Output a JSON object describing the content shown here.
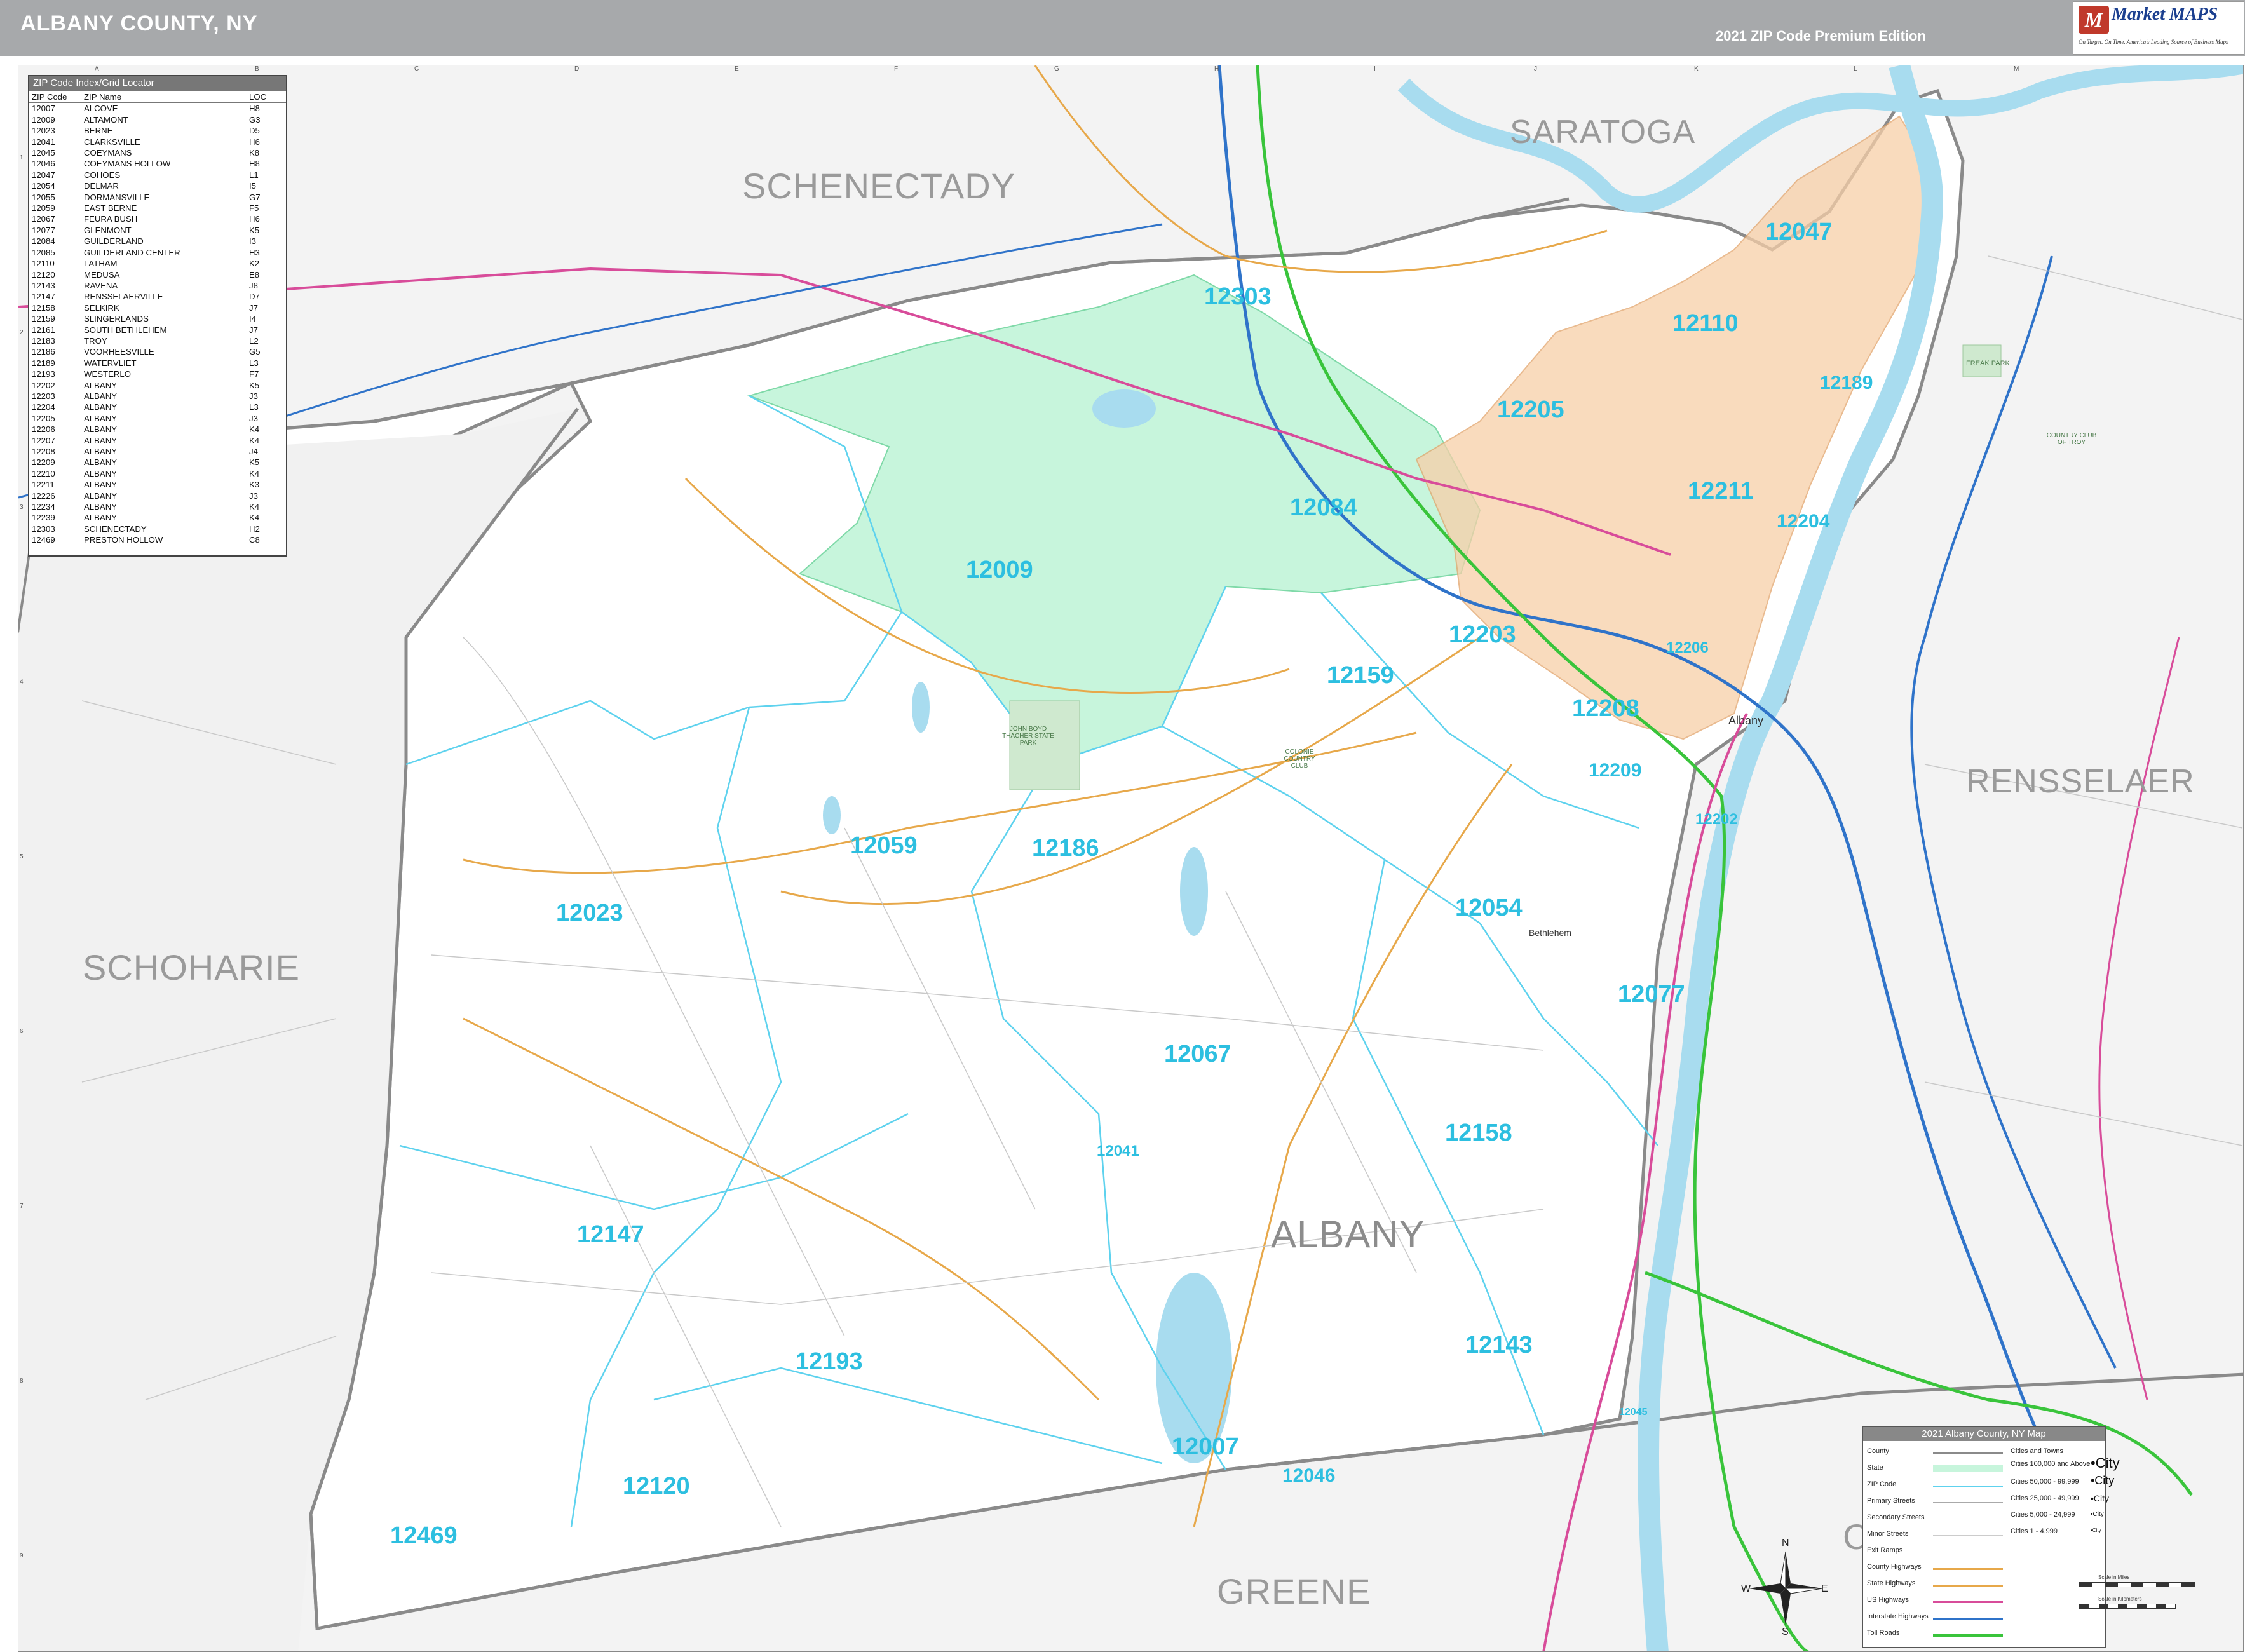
{
  "header": {
    "title": "ALBANY COUNTY, NY",
    "edition": "2021 ZIP Code Premium Edition",
    "logo": {
      "brand": "Market MAPS",
      "mark": "M",
      "tagline": "On Target.  On Time.  America's Leading Source of Business Maps"
    }
  },
  "grid": {
    "columns": [
      "A",
      "B",
      "C",
      "D",
      "E",
      "F",
      "G",
      "H",
      "I",
      "J",
      "K",
      "L",
      "M"
    ],
    "rows": [
      "1",
      "2",
      "3",
      "4",
      "5",
      "6",
      "7",
      "8",
      "9"
    ]
  },
  "index": {
    "title": "ZIP Code Index/Grid Locator",
    "headers": [
      "ZIP Code",
      "ZIP Name",
      "LOC"
    ],
    "rows": [
      [
        "12007",
        "ALCOVE",
        "H8"
      ],
      [
        "12009",
        "ALTAMONT",
        "G3"
      ],
      [
        "12023",
        "BERNE",
        "D5"
      ],
      [
        "12041",
        "CLARKSVILLE",
        "H6"
      ],
      [
        "12045",
        "COEYMANS",
        "K8"
      ],
      [
        "12046",
        "COEYMANS HOLLOW",
        "H8"
      ],
      [
        "12047",
        "COHOES",
        "L1"
      ],
      [
        "12054",
        "DELMAR",
        "I5"
      ],
      [
        "12055",
        "DORMANSVILLE",
        "G7"
      ],
      [
        "12059",
        "EAST BERNE",
        "F5"
      ],
      [
        "12067",
        "FEURA BUSH",
        "H6"
      ],
      [
        "12077",
        "GLENMONT",
        "K5"
      ],
      [
        "12084",
        "GUILDERLAND",
        "I3"
      ],
      [
        "12085",
        "GUILDERLAND CENTER",
        "H3"
      ],
      [
        "12110",
        "LATHAM",
        "K2"
      ],
      [
        "12120",
        "MEDUSA",
        "E8"
      ],
      [
        "12143",
        "RAVENA",
        "J8"
      ],
      [
        "12147",
        "RENSSELAERVILLE",
        "D7"
      ],
      [
        "12158",
        "SELKIRK",
        "J7"
      ],
      [
        "12159",
        "SLINGERLANDS",
        "I4"
      ],
      [
        "12161",
        "SOUTH BETHLEHEM",
        "J7"
      ],
      [
        "12183",
        "TROY",
        "L2"
      ],
      [
        "12186",
        "VOORHEESVILLE",
        "G5"
      ],
      [
        "12189",
        "WATERVLIET",
        "L3"
      ],
      [
        "12193",
        "WESTERLO",
        "F7"
      ],
      [
        "12202",
        "ALBANY",
        "K5"
      ],
      [
        "12203",
        "ALBANY",
        "J3"
      ],
      [
        "12204",
        "ALBANY",
        "L3"
      ],
      [
        "12205",
        "ALBANY",
        "J3"
      ],
      [
        "12206",
        "ALBANY",
        "K4"
      ],
      [
        "12207",
        "ALBANY",
        "K4"
      ],
      [
        "12208",
        "ALBANY",
        "J4"
      ],
      [
        "12209",
        "ALBANY",
        "K5"
      ],
      [
        "12210",
        "ALBANY",
        "K4"
      ],
      [
        "12211",
        "ALBANY",
        "K3"
      ],
      [
        "12226",
        "ALBANY",
        "J3"
      ],
      [
        "12234",
        "ALBANY",
        "K4"
      ],
      [
        "12239",
        "ALBANY",
        "K4"
      ],
      [
        "12303",
        "SCHENECTADY",
        "H2"
      ],
      [
        "12469",
        "PRESTON HOLLOW",
        "C8"
      ]
    ]
  },
  "counties": {
    "schenectady": "SCHENECTADY",
    "saratoga": "SARATOGA",
    "rensselaer": "RENSSELAER",
    "schoharie": "SCHOHARIE",
    "albany": "ALBANY",
    "greene": "GREENE",
    "columbia_partial": "C"
  },
  "zips": {
    "z12303": "12303",
    "z12047": "12047",
    "z12110": "12110",
    "z12189": "12189",
    "z12205": "12205",
    "z12211": "12211",
    "z12084": "12084",
    "z12204": "12204",
    "z12009": "12009",
    "z12203": "12203",
    "z12206": "12206",
    "z12159": "12159",
    "z12208": "12208",
    "z12209": "12209",
    "z12202": "12202",
    "z12059": "12059",
    "z12186": "12186",
    "z12023": "12023",
    "z12054": "12054",
    "z12077": "12077",
    "z12067": "12067",
    "z12158": "12158",
    "z12041": "12041",
    "z12147": "12147",
    "z12143": "12143",
    "z12193": "12193",
    "z12007": "12007",
    "z12046": "12046",
    "z12120": "12120",
    "z12469": "12469",
    "z12045": "12045"
  },
  "places": {
    "albany": "Albany",
    "bethlehem": "Bethlehem",
    "freak_park": "FREAK PARK",
    "country_club_troy": "COUNTRY CLUB OF TROY",
    "thacher_park": "JOHN BOYD THACHER STATE PARK",
    "colonie_club": "COLONIE COUNTRY CLUB"
  },
  "legend": {
    "title": "2021 Albany County, NY Map",
    "items": [
      "County",
      "State",
      "ZIP Code",
      "Primary Streets",
      "Secondary Streets",
      "Minor Streets",
      "Exit Ramps",
      "County Highways",
      "State Highways",
      "US Highways",
      "Interstate Highways",
      "Toll Roads"
    ],
    "cities_header": "Cities and Towns",
    "cities": [
      {
        "range": "Cities 100,000 and Above",
        "sample": "•City"
      },
      {
        "range": "Cities 50,000 - 99,999",
        "sample": "•City"
      },
      {
        "range": "Cities 25,000 - 49,999",
        "sample": "•City"
      },
      {
        "range": "Cities 5,000 - 24,999",
        "sample": "•City"
      },
      {
        "range": "Cities 1 - 4,999",
        "sample": "•City"
      }
    ],
    "scale_miles": "Scale in Miles",
    "scale_km": "Scale in Kilometers"
  },
  "compass": {
    "n": "N",
    "s": "S",
    "e": "E",
    "w": "W"
  },
  "colors": {
    "zip_label": "#2dbfe0",
    "county_label": "#9a9a9a",
    "county_fill": "#ffffff",
    "outside_fill": "#f3f3f3",
    "water": "#a8dcef",
    "urban": "#f7cfa8",
    "highlight_zip": "#c7f5dc",
    "interstate": "#2f73c9",
    "us_highway": "#d84c9a",
    "state_highway": "#e7a84a",
    "toll_road": "#39c43b"
  }
}
